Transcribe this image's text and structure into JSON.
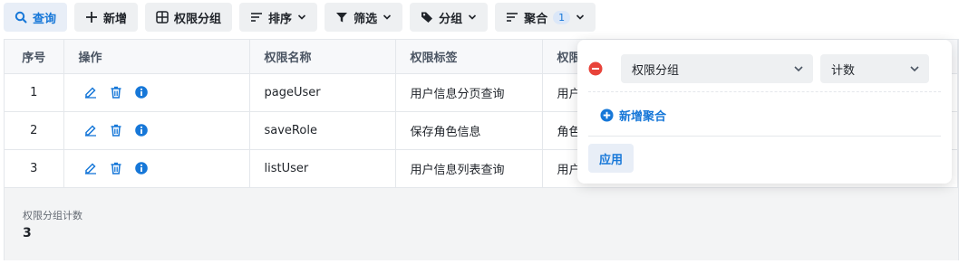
{
  "toolbar": {
    "query_label": "查询",
    "add_label": "新增",
    "group_label": "权限分组",
    "sort_label": "排序",
    "filter_label": "筛选",
    "groupby_label": "分组",
    "aggregate_label": "聚合",
    "aggregate_count": "1"
  },
  "table": {
    "headers": [
      "序号",
      "操作",
      "权限名称",
      "权限标签",
      "权限"
    ],
    "rows": [
      {
        "index": "1",
        "name": "pageUser",
        "tag": "用户信息分页查询",
        "extra": "用户"
      },
      {
        "index": "2",
        "name": "saveRole",
        "tag": "保存角色信息",
        "extra": "角色"
      },
      {
        "index": "3",
        "name": "listUser",
        "tag": "用户信息列表查询",
        "extra": "用户"
      }
    ]
  },
  "summary": {
    "label": "权限分组计数",
    "value": "3"
  },
  "popover": {
    "field_value": "权限分组",
    "agg_value": "计数",
    "add_label": "新增聚合",
    "apply_label": "应用"
  },
  "colors": {
    "accent": "#1677d8",
    "danger": "#e8433a"
  }
}
